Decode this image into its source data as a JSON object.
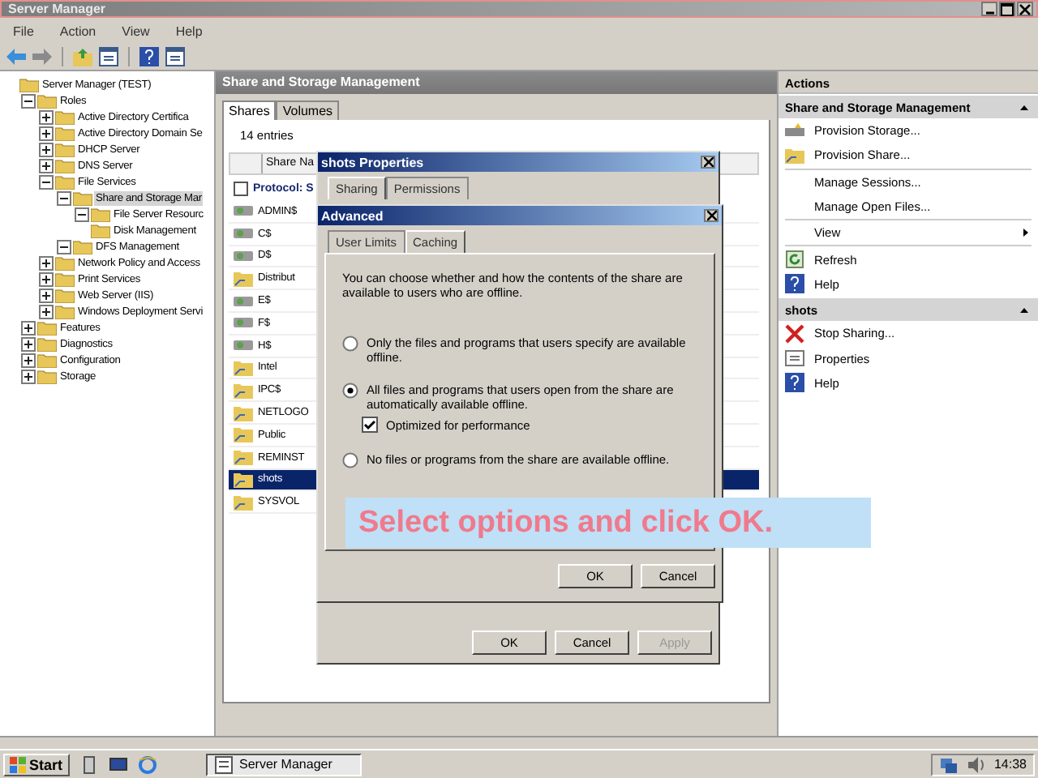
{
  "window": {
    "title": "Server Manager"
  },
  "menu": [
    "File",
    "Action",
    "View",
    "Help"
  ],
  "tree": [
    {
      "label": "Server Manager (TEST)",
      "selected": false,
      "children": [
        {
          "label": "Roles",
          "expanded": true,
          "selected": false,
          "children": [
            {
              "label": "Active Directory Certifica",
              "expanded": false,
              "selected": false
            },
            {
              "label": "Active Directory Domain Se",
              "expanded": false,
              "selected": false
            },
            {
              "label": "DHCP Server",
              "expanded": false,
              "selected": false
            },
            {
              "label": "DNS Server",
              "expanded": false,
              "selected": false
            },
            {
              "label": "File Services",
              "expanded": true,
              "selected": false,
              "children": [
                {
                  "label": "Share and Storage Mar",
                  "expanded": true,
                  "selected": true,
                  "children": [
                    {
                      "label": "File Server Resourc",
                      "expanded": true,
                      "selected": false
                    },
                    {
                      "label": "Disk Management",
                      "selected": false
                    }
                  ]
                },
                {
                  "label": "DFS Management",
                  "expanded": true,
                  "selected": false
                }
              ]
            },
            {
              "label": "Network Policy and Access",
              "expanded": false,
              "selected": false
            },
            {
              "label": "Print Services",
              "expanded": false,
              "selected": false
            },
            {
              "label": "Web Server (IIS)",
              "expanded": false,
              "selected": false
            },
            {
              "label": "Windows Deployment Servi",
              "expanded": false,
              "selected": false
            }
          ]
        },
        {
          "label": "Features",
          "expanded": false,
          "selected": false
        },
        {
          "label": "Diagnostics",
          "expanded": false,
          "selected": false
        },
        {
          "label": "Configuration",
          "expanded": false,
          "selected": false
        },
        {
          "label": "Storage",
          "expanded": false,
          "selected": false
        }
      ]
    }
  ],
  "center": {
    "title": "Share and Storage Management",
    "tabs": [
      {
        "label": "Shares",
        "selected": true
      },
      {
        "label": "Volumes",
        "selected": false
      }
    ],
    "count": "14 entries",
    "table": {
      "columns": [
        "Share Na"
      ],
      "group": {
        "label": "Protocol: S",
        "checked": false
      },
      "rows": [
        {
          "name": "ADMIN$",
          "kind": "admin",
          "selected": false
        },
        {
          "name": "C$",
          "kind": "admin",
          "selected": false
        },
        {
          "name": "D$",
          "kind": "admin",
          "selected": false
        },
        {
          "name": "Distribut",
          "kind": "folder",
          "selected": false
        },
        {
          "name": "E$",
          "kind": "admin",
          "selected": false
        },
        {
          "name": "F$",
          "kind": "admin",
          "selected": false
        },
        {
          "name": "H$",
          "kind": "admin",
          "selected": false
        },
        {
          "name": "Intel",
          "kind": "folder",
          "selected": false
        },
        {
          "name": "IPC$",
          "kind": "folder",
          "selected": false
        },
        {
          "name": "NETLOGO",
          "kind": "folder",
          "selected": false
        },
        {
          "name": "Public",
          "kind": "folder",
          "selected": false
        },
        {
          "name": "REMINST",
          "kind": "folder",
          "selected": false
        },
        {
          "name": "shots",
          "kind": "folder",
          "selected": true
        },
        {
          "name": "SYSVOL",
          "kind": "folder",
          "selected": false
        }
      ]
    }
  },
  "actions": {
    "title": "Actions",
    "sections": [
      {
        "title": "Share and Storage Management",
        "items": [
          {
            "label": "Provision Storage...",
            "kind": "storage"
          },
          {
            "label": "Provision Share...",
            "kind": "share"
          },
          {
            "label": "Manage Sessions...",
            "kind": "plain"
          },
          {
            "label": "Manage Open Files...",
            "kind": "plain"
          },
          {
            "label": "View",
            "kind": "submenu"
          },
          {
            "label": "Refresh",
            "kind": "refresh"
          },
          {
            "label": "Help",
            "kind": "help"
          }
        ]
      },
      {
        "title": "shots",
        "items": [
          {
            "label": "Stop Sharing...",
            "kind": "stop"
          },
          {
            "label": "Properties",
            "kind": "properties"
          },
          {
            "label": "Help",
            "kind": "help"
          }
        ]
      }
    ]
  },
  "properties_dialog": {
    "title": "shots Properties",
    "tabs": [
      {
        "label": "Sharing",
        "selected": true
      },
      {
        "label": "Permissions",
        "selected": false
      }
    ],
    "buttons": [
      {
        "label": "OK",
        "disabled": false
      },
      {
        "label": "Cancel",
        "disabled": false
      },
      {
        "label": "Apply",
        "disabled": true
      }
    ]
  },
  "advanced_dialog": {
    "title": "Advanced",
    "tabs": [
      {
        "label": "User Limits",
        "selected": false
      },
      {
        "label": "Caching",
        "selected": true
      }
    ],
    "intro": "You can choose whether and how the contents of the share are available to users who are offline.",
    "options": [
      {
        "label": "Only the files and programs that users specify are available offline.",
        "selected": false
      },
      {
        "label": "All files and programs that users open from the share are automatically available offline.",
        "selected": true,
        "checkbox": {
          "label": "Optimized for performance",
          "checked": true
        }
      },
      {
        "label": "No files or programs from the share are available offline.",
        "selected": false
      }
    ],
    "buttons": [
      "OK",
      "Cancel"
    ]
  },
  "caption": "Select options and click **OK**.",
  "taskbar": {
    "start": "Start",
    "task": "Server Manager",
    "clock": "14:38"
  }
}
